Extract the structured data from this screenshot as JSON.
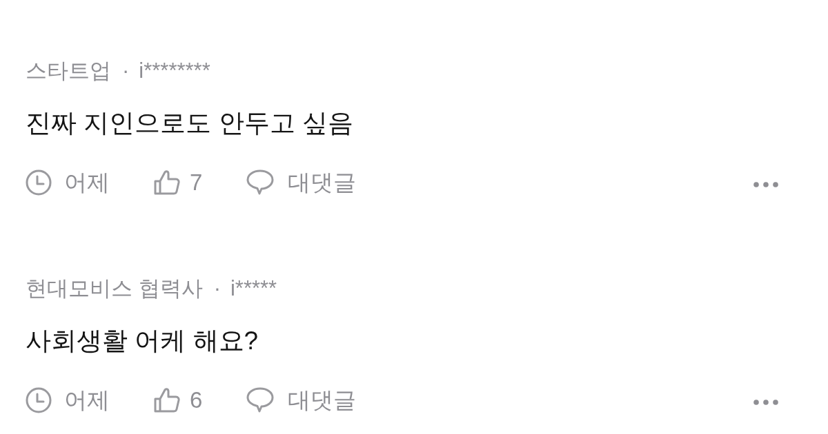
{
  "comments": [
    {
      "affiliation": "스타트업",
      "separator": "·",
      "user": "i********",
      "text": "진짜 지인으로도 안두고 싶음",
      "time": "어제",
      "likes": "7",
      "reply_label": "대댓글"
    },
    {
      "affiliation": "현대모비스 협력사",
      "separator": "·",
      "user": "i*****",
      "text": "사회생활 어케 해요?",
      "time": "어제",
      "likes": "6",
      "reply_label": "대댓글"
    }
  ]
}
